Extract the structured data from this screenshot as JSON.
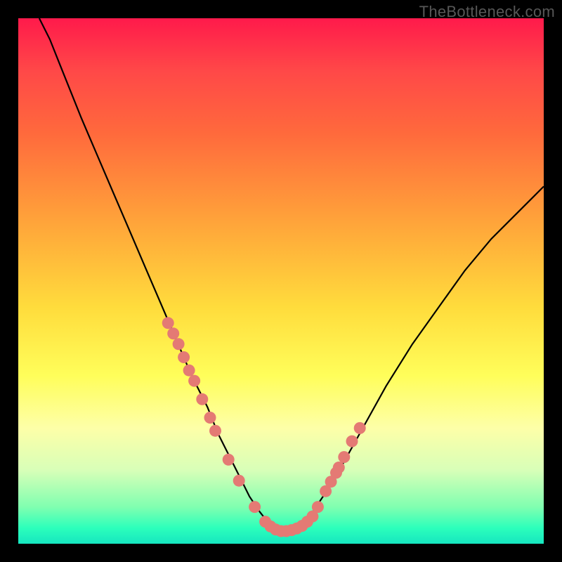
{
  "watermark": "TheBottleneck.com",
  "colors": {
    "frame": "#000000",
    "gradient_css": "linear-gradient(to bottom, #ff1a4b 0%, #ff4848 10%, #ff6a3c 22%, #ffa83a 40%, #ffdc3c 55%, #fffe5a 68%, #fdffa8 78%, #d8ffb8 86%, #80ffb0 93%, #2cffbb 97%, #16e6c0 100%)",
    "curve": "#000000",
    "dot": "#e47a74"
  },
  "chart_data": {
    "type": "line",
    "title": "",
    "xlabel": "",
    "ylabel": "",
    "xlim": [
      0,
      100
    ],
    "ylim": [
      0,
      100
    ],
    "series": [
      {
        "name": "bottleneck-curve",
        "x": [
          4,
          6,
          8,
          10,
          12,
          15,
          18,
          21,
          24,
          27,
          30,
          33,
          36,
          38,
          40,
          42,
          44,
          46,
          48,
          50,
          52,
          54,
          56,
          60,
          65,
          70,
          75,
          80,
          85,
          90,
          95,
          100
        ],
        "y": [
          100,
          96,
          91,
          86,
          81,
          74,
          67,
          60,
          53,
          46,
          39,
          32,
          26,
          21,
          17,
          13,
          9,
          6,
          3.5,
          2.2,
          2.2,
          3.5,
          6,
          12,
          21,
          30,
          38,
          45,
          52,
          58,
          63,
          68
        ]
      }
    ],
    "scatter": [
      {
        "name": "sample-dots",
        "points": [
          {
            "x": 28.5,
            "y": 42
          },
          {
            "x": 29.5,
            "y": 40
          },
          {
            "x": 30.5,
            "y": 38
          },
          {
            "x": 31.5,
            "y": 35.5
          },
          {
            "x": 32.5,
            "y": 33
          },
          {
            "x": 33.5,
            "y": 31
          },
          {
            "x": 35.0,
            "y": 27.5
          },
          {
            "x": 36.5,
            "y": 24
          },
          {
            "x": 37.5,
            "y": 21.5
          },
          {
            "x": 40.0,
            "y": 16
          },
          {
            "x": 42.0,
            "y": 12
          },
          {
            "x": 45.0,
            "y": 7
          },
          {
            "x": 47.0,
            "y": 4.2
          },
          {
            "x": 48.0,
            "y": 3.3
          },
          {
            "x": 49.0,
            "y": 2.7
          },
          {
            "x": 50.0,
            "y": 2.4
          },
          {
            "x": 51.0,
            "y": 2.4
          },
          {
            "x": 52.0,
            "y": 2.6
          },
          {
            "x": 53.0,
            "y": 2.9
          },
          {
            "x": 54.0,
            "y": 3.4
          },
          {
            "x": 55.0,
            "y": 4.2
          },
          {
            "x": 57.0,
            "y": 7
          },
          {
            "x": 58.5,
            "y": 10
          },
          {
            "x": 60.5,
            "y": 13.5
          },
          {
            "x": 56.0,
            "y": 5.2
          },
          {
            "x": 62.0,
            "y": 16.5
          },
          {
            "x": 63.5,
            "y": 19.5
          },
          {
            "x": 65.0,
            "y": 22
          },
          {
            "x": 61.0,
            "y": 14.5
          },
          {
            "x": 59.5,
            "y": 11.8
          }
        ]
      }
    ]
  }
}
